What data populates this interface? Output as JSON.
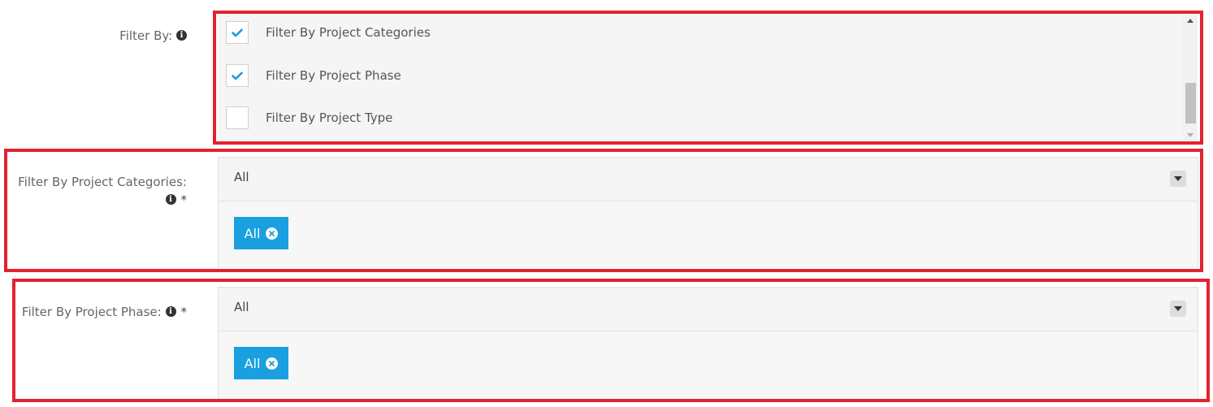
{
  "filter_by": {
    "label": "Filter By:",
    "options": [
      {
        "label": "Filter By Project Categories",
        "checked": true
      },
      {
        "label": "Filter By Project Phase",
        "checked": true
      },
      {
        "label": "Filter By Project Type",
        "checked": false
      }
    ]
  },
  "categories": {
    "label": "Filter By Project Categories:",
    "required_mark": "*",
    "selected_value": "All",
    "tag_label": "All"
  },
  "phase": {
    "label": "Filter By Project Phase:",
    "required_mark": "*",
    "selected_value": "All",
    "tag_label": "All"
  },
  "colors": {
    "highlight": "#e3222f",
    "tag": "#1a9fe0",
    "check": "#1a9fe0"
  },
  "icons": {
    "info": "info-icon",
    "check": "check-icon",
    "dropdown": "caret-down-icon",
    "remove": "remove-tag-icon"
  }
}
